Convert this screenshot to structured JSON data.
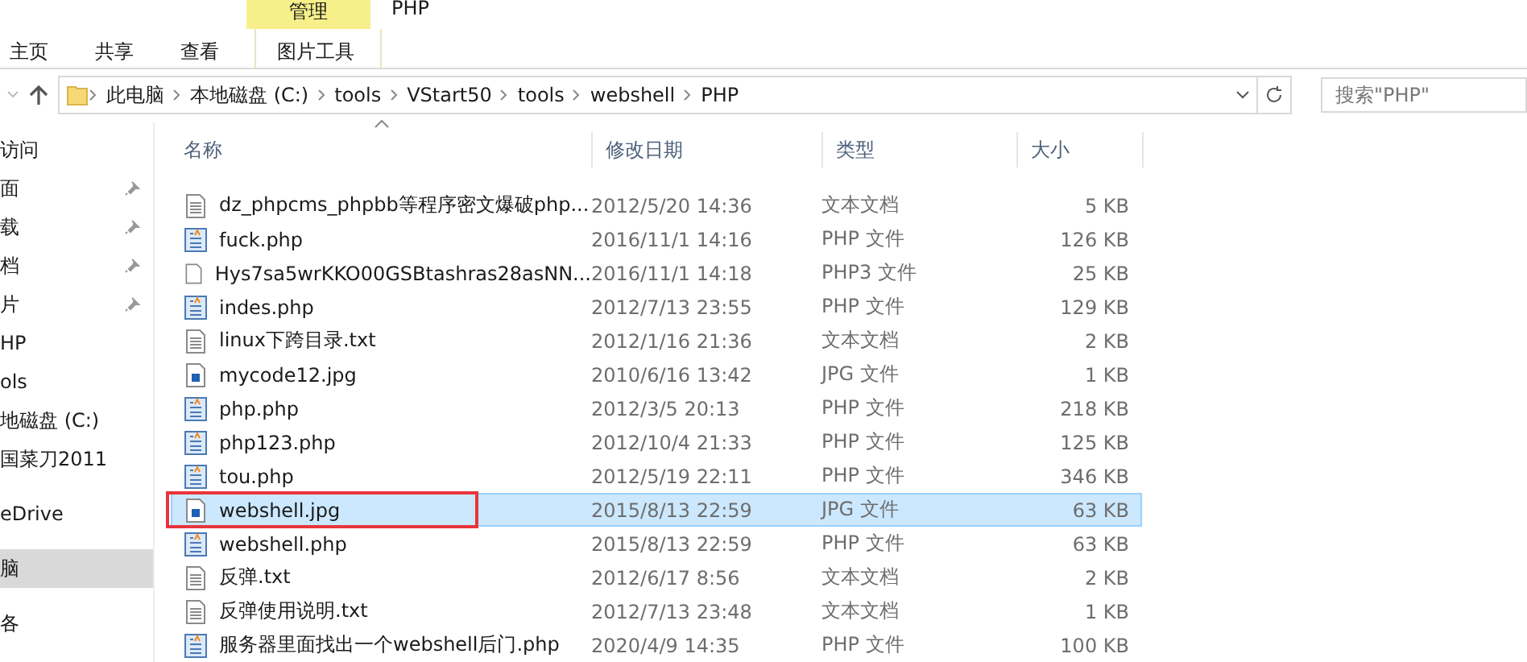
{
  "window": {
    "title": "PHP",
    "context_tab": "管理"
  },
  "ribbon_tabs": [
    {
      "label": "主页",
      "selected": false
    },
    {
      "label": "共享",
      "selected": false
    },
    {
      "label": "查看",
      "selected": false
    },
    {
      "label": "图片工具",
      "selected": false,
      "kind": "context"
    }
  ],
  "address": {
    "crumbs": [
      "此电脑",
      "本地磁盘 (C:)",
      "tools",
      "VStart50",
      "tools",
      "webshell",
      "PHP"
    ]
  },
  "search": {
    "placeholder": "搜索\"PHP\""
  },
  "sidebar": {
    "groups": [
      {
        "items": [
          {
            "label": "访问",
            "pinned": false,
            "selected": false
          },
          {
            "label": "面",
            "pinned": true,
            "selected": false
          },
          {
            "label": "载",
            "pinned": true,
            "selected": false
          },
          {
            "label": "档",
            "pinned": true,
            "selected": false
          },
          {
            "label": "片",
            "pinned": true,
            "selected": false
          },
          {
            "label": "HP",
            "pinned": false,
            "selected": false
          },
          {
            "label": "ols",
            "pinned": false,
            "selected": false
          },
          {
            "label": "地磁盘 (C:)",
            "pinned": false,
            "selected": false
          },
          {
            "label": "国菜刀2011",
            "pinned": false,
            "selected": false
          }
        ]
      },
      {
        "items": [
          {
            "label": "eDrive",
            "pinned": false,
            "selected": false
          }
        ]
      },
      {
        "items": [
          {
            "label": "脑",
            "pinned": false,
            "selected": true
          }
        ]
      },
      {
        "items": [
          {
            "label": "各",
            "pinned": false,
            "selected": false
          }
        ]
      }
    ]
  },
  "table": {
    "columns": [
      "名称",
      "修改日期",
      "类型",
      "大小"
    ],
    "rows": [
      {
        "name": "dz_phpcms_phpbb等程序密文爆破php...",
        "date": "2012/5/20 14:36",
        "type": "文本文档",
        "size": "5 KB",
        "kind": "txt",
        "selected": false,
        "outlined": false
      },
      {
        "name": "fuck.php",
        "date": "2016/11/1 14:16",
        "type": "PHP 文件",
        "size": "126 KB",
        "kind": "php",
        "selected": false,
        "outlined": false
      },
      {
        "name": "Hys7sa5wrKKO00GSBtashras28asNN...",
        "date": "2016/11/1 14:18",
        "type": "PHP3 文件",
        "size": "25 KB",
        "kind": "blank",
        "selected": false,
        "outlined": false
      },
      {
        "name": "indes.php",
        "date": "2012/7/13 23:55",
        "type": "PHP 文件",
        "size": "129 KB",
        "kind": "php",
        "selected": false,
        "outlined": false
      },
      {
        "name": "linux下跨目录.txt",
        "date": "2012/1/16 21:36",
        "type": "文本文档",
        "size": "2 KB",
        "kind": "txt",
        "selected": false,
        "outlined": false
      },
      {
        "name": "mycode12.jpg",
        "date": "2010/6/16 13:42",
        "type": "JPG 文件",
        "size": "1 KB",
        "kind": "jpg",
        "selected": false,
        "outlined": false
      },
      {
        "name": "php.php",
        "date": "2012/3/5 20:13",
        "type": "PHP 文件",
        "size": "218 KB",
        "kind": "php",
        "selected": false,
        "outlined": false
      },
      {
        "name": "php123.php",
        "date": "2012/10/4 21:33",
        "type": "PHP 文件",
        "size": "125 KB",
        "kind": "php",
        "selected": false,
        "outlined": false
      },
      {
        "name": "tou.php",
        "date": "2012/5/19 22:11",
        "type": "PHP 文件",
        "size": "346 KB",
        "kind": "php",
        "selected": false,
        "outlined": false
      },
      {
        "name": "webshell.jpg",
        "date": "2015/8/13 22:59",
        "type": "JPG 文件",
        "size": "63 KB",
        "kind": "jpg",
        "selected": true,
        "outlined": true
      },
      {
        "name": "webshell.php",
        "date": "2015/8/13 22:59",
        "type": "PHP 文件",
        "size": "63 KB",
        "kind": "php",
        "selected": false,
        "outlined": false
      },
      {
        "name": "反弹.txt",
        "date": "2012/6/17 8:56",
        "type": "文本文档",
        "size": "2 KB",
        "kind": "txt",
        "selected": false,
        "outlined": false
      },
      {
        "name": "反弹使用说明.txt",
        "date": "2012/7/13 23:48",
        "type": "文本文档",
        "size": "1 KB",
        "kind": "txt",
        "selected": false,
        "outlined": false
      },
      {
        "name": "服务器里面找出一个webshell后门.php",
        "date": "2020/4/9 14:35",
        "type": "PHP 文件",
        "size": "100 KB",
        "kind": "php",
        "selected": false,
        "outlined": false
      }
    ]
  }
}
